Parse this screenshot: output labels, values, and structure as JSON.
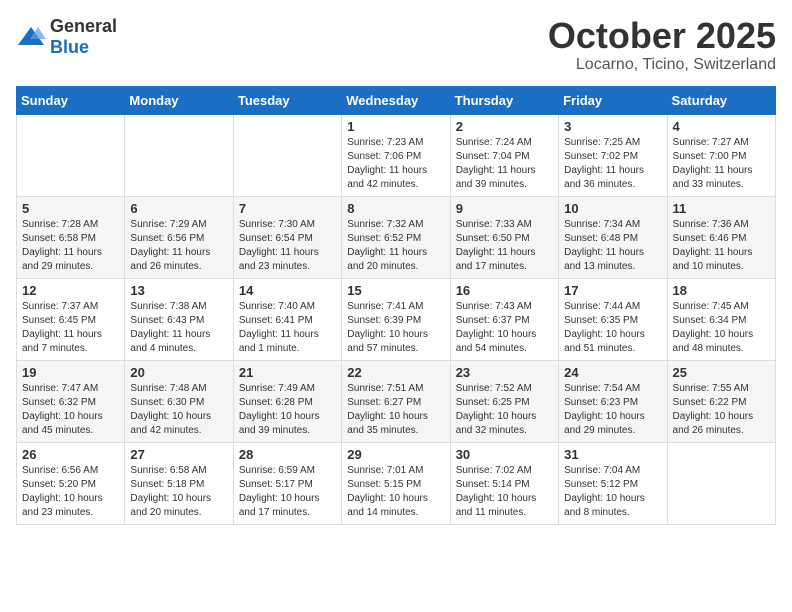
{
  "header": {
    "logo_general": "General",
    "logo_blue": "Blue",
    "month": "October 2025",
    "location": "Locarno, Ticino, Switzerland"
  },
  "days_of_week": [
    "Sunday",
    "Monday",
    "Tuesday",
    "Wednesday",
    "Thursday",
    "Friday",
    "Saturday"
  ],
  "weeks": [
    [
      {
        "day": "",
        "info": ""
      },
      {
        "day": "",
        "info": ""
      },
      {
        "day": "",
        "info": ""
      },
      {
        "day": "1",
        "info": "Sunrise: 7:23 AM\nSunset: 7:06 PM\nDaylight: 11 hours and 42 minutes."
      },
      {
        "day": "2",
        "info": "Sunrise: 7:24 AM\nSunset: 7:04 PM\nDaylight: 11 hours and 39 minutes."
      },
      {
        "day": "3",
        "info": "Sunrise: 7:25 AM\nSunset: 7:02 PM\nDaylight: 11 hours and 36 minutes."
      },
      {
        "day": "4",
        "info": "Sunrise: 7:27 AM\nSunset: 7:00 PM\nDaylight: 11 hours and 33 minutes."
      }
    ],
    [
      {
        "day": "5",
        "info": "Sunrise: 7:28 AM\nSunset: 6:58 PM\nDaylight: 11 hours and 29 minutes."
      },
      {
        "day": "6",
        "info": "Sunrise: 7:29 AM\nSunset: 6:56 PM\nDaylight: 11 hours and 26 minutes."
      },
      {
        "day": "7",
        "info": "Sunrise: 7:30 AM\nSunset: 6:54 PM\nDaylight: 11 hours and 23 minutes."
      },
      {
        "day": "8",
        "info": "Sunrise: 7:32 AM\nSunset: 6:52 PM\nDaylight: 11 hours and 20 minutes."
      },
      {
        "day": "9",
        "info": "Sunrise: 7:33 AM\nSunset: 6:50 PM\nDaylight: 11 hours and 17 minutes."
      },
      {
        "day": "10",
        "info": "Sunrise: 7:34 AM\nSunset: 6:48 PM\nDaylight: 11 hours and 13 minutes."
      },
      {
        "day": "11",
        "info": "Sunrise: 7:36 AM\nSunset: 6:46 PM\nDaylight: 11 hours and 10 minutes."
      }
    ],
    [
      {
        "day": "12",
        "info": "Sunrise: 7:37 AM\nSunset: 6:45 PM\nDaylight: 11 hours and 7 minutes."
      },
      {
        "day": "13",
        "info": "Sunrise: 7:38 AM\nSunset: 6:43 PM\nDaylight: 11 hours and 4 minutes."
      },
      {
        "day": "14",
        "info": "Sunrise: 7:40 AM\nSunset: 6:41 PM\nDaylight: 11 hours and 1 minute."
      },
      {
        "day": "15",
        "info": "Sunrise: 7:41 AM\nSunset: 6:39 PM\nDaylight: 10 hours and 57 minutes."
      },
      {
        "day": "16",
        "info": "Sunrise: 7:43 AM\nSunset: 6:37 PM\nDaylight: 10 hours and 54 minutes."
      },
      {
        "day": "17",
        "info": "Sunrise: 7:44 AM\nSunset: 6:35 PM\nDaylight: 10 hours and 51 minutes."
      },
      {
        "day": "18",
        "info": "Sunrise: 7:45 AM\nSunset: 6:34 PM\nDaylight: 10 hours and 48 minutes."
      }
    ],
    [
      {
        "day": "19",
        "info": "Sunrise: 7:47 AM\nSunset: 6:32 PM\nDaylight: 10 hours and 45 minutes."
      },
      {
        "day": "20",
        "info": "Sunrise: 7:48 AM\nSunset: 6:30 PM\nDaylight: 10 hours and 42 minutes."
      },
      {
        "day": "21",
        "info": "Sunrise: 7:49 AM\nSunset: 6:28 PM\nDaylight: 10 hours and 39 minutes."
      },
      {
        "day": "22",
        "info": "Sunrise: 7:51 AM\nSunset: 6:27 PM\nDaylight: 10 hours and 35 minutes."
      },
      {
        "day": "23",
        "info": "Sunrise: 7:52 AM\nSunset: 6:25 PM\nDaylight: 10 hours and 32 minutes."
      },
      {
        "day": "24",
        "info": "Sunrise: 7:54 AM\nSunset: 6:23 PM\nDaylight: 10 hours and 29 minutes."
      },
      {
        "day": "25",
        "info": "Sunrise: 7:55 AM\nSunset: 6:22 PM\nDaylight: 10 hours and 26 minutes."
      }
    ],
    [
      {
        "day": "26",
        "info": "Sunrise: 6:56 AM\nSunset: 5:20 PM\nDaylight: 10 hours and 23 minutes."
      },
      {
        "day": "27",
        "info": "Sunrise: 6:58 AM\nSunset: 5:18 PM\nDaylight: 10 hours and 20 minutes."
      },
      {
        "day": "28",
        "info": "Sunrise: 6:59 AM\nSunset: 5:17 PM\nDaylight: 10 hours and 17 minutes."
      },
      {
        "day": "29",
        "info": "Sunrise: 7:01 AM\nSunset: 5:15 PM\nDaylight: 10 hours and 14 minutes."
      },
      {
        "day": "30",
        "info": "Sunrise: 7:02 AM\nSunset: 5:14 PM\nDaylight: 10 hours and 11 minutes."
      },
      {
        "day": "31",
        "info": "Sunrise: 7:04 AM\nSunset: 5:12 PM\nDaylight: 10 hours and 8 minutes."
      },
      {
        "day": "",
        "info": ""
      }
    ]
  ]
}
